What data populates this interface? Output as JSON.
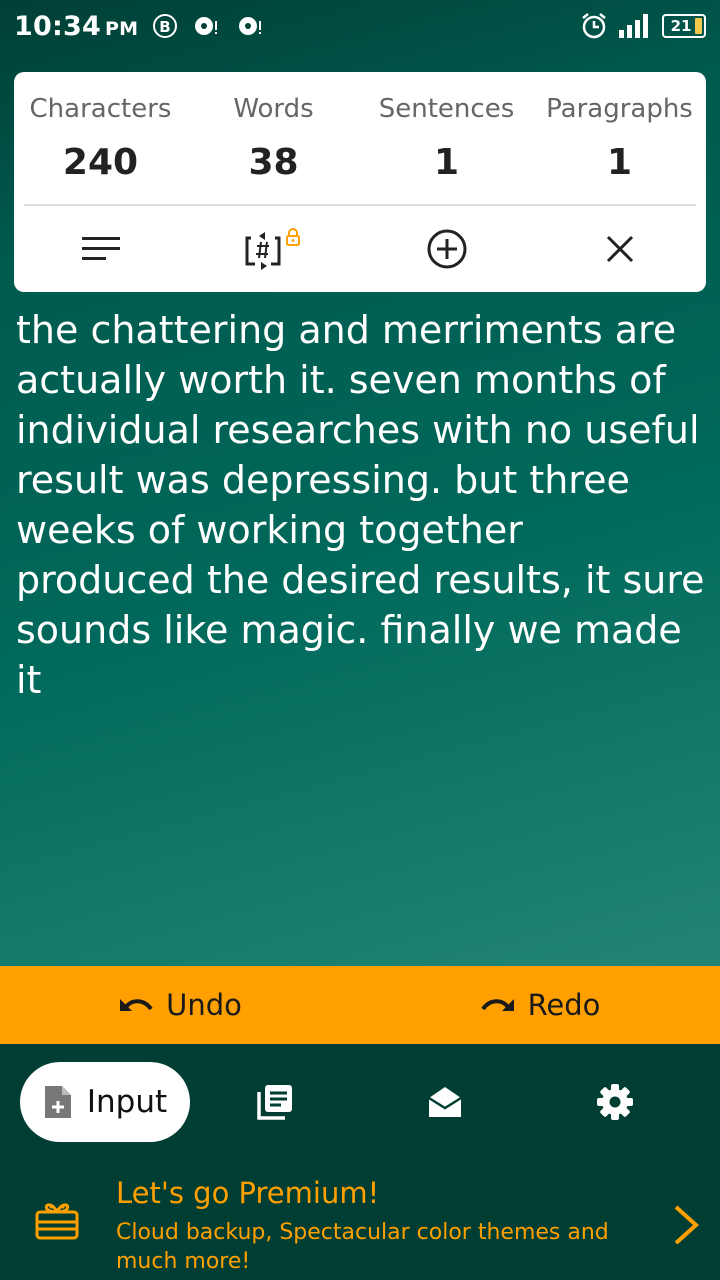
{
  "status_bar": {
    "time": "10:34",
    "ampm": "PM",
    "battery": "21"
  },
  "stats": {
    "items": [
      {
        "label": "Characters",
        "value": "240"
      },
      {
        "label": "Words",
        "value": "38"
      },
      {
        "label": "Sentences",
        "value": "1"
      },
      {
        "label": "Paragraphs",
        "value": "1"
      }
    ]
  },
  "icons": {
    "tools": [
      "text-align-icon",
      "hashtag-sync-icon",
      "add-circle-icon",
      "close-icon"
    ],
    "nav": [
      "new-document-icon",
      "library-icon",
      "inbox-icon",
      "settings-icon"
    ]
  },
  "editor": {
    "text": "the chattering and merriments are actually worth it. seven months of individual researches with no useful result was depressing. but three weeks of working together produced the desired results, it sure sounds like magic. finally we made it"
  },
  "actions": {
    "undo": "Undo",
    "redo": "Redo"
  },
  "nav": {
    "input_label": "Input"
  },
  "premium": {
    "title": "Let's go Premium!",
    "subtitle": "Cloud backup, Spectacular color themes and much more!"
  },
  "colors": {
    "accent": "#ffa000",
    "nav_bg": "#003d33",
    "bg_top": "#003f36",
    "bg_bottom": "#3a9383"
  }
}
